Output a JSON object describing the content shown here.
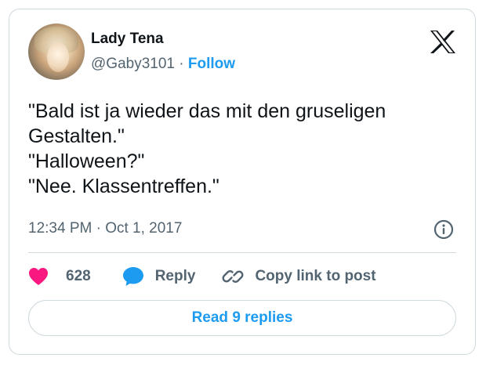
{
  "author": {
    "display_name": "Lady Tena",
    "handle": "@Gaby3101",
    "separator": "·",
    "follow_label": "Follow"
  },
  "tweet": {
    "lines": [
      "\"Bald ist ja wieder das mit den gruseligen",
      "Gestalten.\"",
      "\"Halloween?\"",
      "\"Nee. Klassentreffen.\""
    ],
    "timestamp": "12:34 PM · Oct 1, 2017"
  },
  "actions": {
    "like_count": "628",
    "reply_label": "Reply",
    "copy_link_label": "Copy link to post"
  },
  "read_replies_label": "Read 9 replies",
  "icons": {
    "logo": "x-logo-icon",
    "info": "info-icon",
    "like": "heart-icon",
    "reply": "speech-bubble-icon",
    "copy": "link-icon"
  },
  "colors": {
    "accent": "#1d9bf0",
    "like": "#f91880",
    "text": "#0f1419",
    "muted": "#536471",
    "border": "#cfd9de"
  }
}
